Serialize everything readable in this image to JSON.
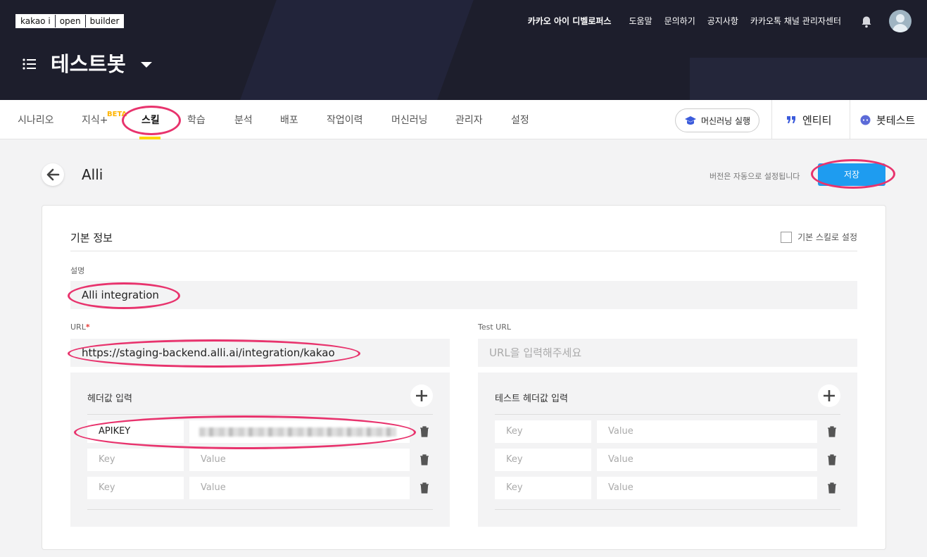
{
  "header": {
    "logo": [
      "kakao i",
      "open",
      "builder"
    ],
    "nav": [
      "카카오 아이 디벨로퍼스",
      "도움말",
      "문의하기",
      "공지사항",
      "카카오톡 채널 관리자센터"
    ],
    "bot_name": "테스트봇",
    "icons": [
      "menu-icon",
      "bell-icon",
      "avatar",
      "caret-down-icon"
    ]
  },
  "tabs": {
    "items": [
      "시나리오",
      "지식+",
      "스킬",
      "학습",
      "분석",
      "배포",
      "작업이력",
      "머신러닝",
      "관리자",
      "설정"
    ],
    "beta": "BETA",
    "active": "스킬",
    "ml_run": "머신러닝 실행",
    "entity": "엔티티",
    "bottest": "봇테스트"
  },
  "page": {
    "skill_name": "Alli",
    "version_note": "버전은 자동으로 설정됩니다",
    "save": "저장"
  },
  "form": {
    "section_title": "기본 정보",
    "default_skill": "기본 스킬로 설정",
    "desc_label": "설명",
    "desc_value": "Alli integration",
    "url_label": "URL",
    "url_required": "*",
    "url_value": "https://staging-backend.alli.ai/integration/kakao",
    "test_url_label": "Test URL",
    "test_url_placeholder": "URL을 입력해주세요",
    "header_title": "헤더값 입력",
    "test_header_title": "테스트 헤더값 입력",
    "key_placeholder": "Key",
    "value_placeholder": "Value",
    "header_key_1": "APIKEY"
  },
  "colors": {
    "header_bg": "#1d1e2c",
    "accent": "#1e9cf0",
    "tab_underline": "#ffd600",
    "annotation": "#e8336d"
  }
}
